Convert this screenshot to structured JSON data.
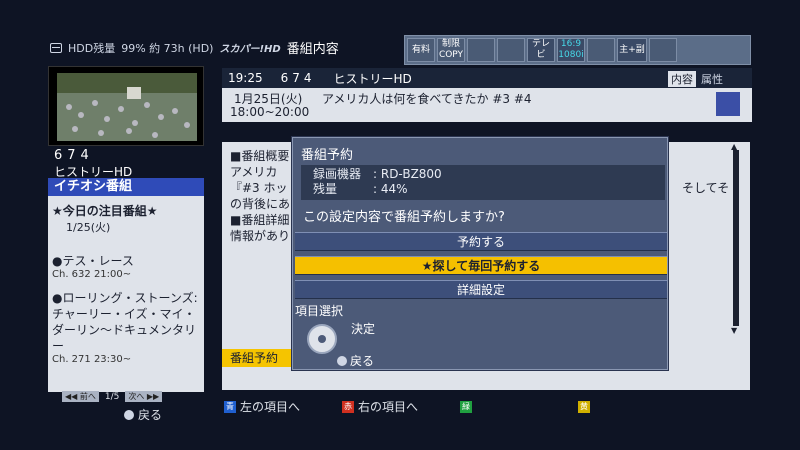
{
  "status": {
    "hdd_label": "HDD残量",
    "hdd_value": "99% 約 73h (HD)",
    "brand": "スカパー!HD",
    "screen_title": "番組内容"
  },
  "badges": [
    "有料",
    "制限COPY",
    "",
    "",
    "テレビ",
    "16:9 1080i",
    "",
    "主+副",
    ""
  ],
  "channel": {
    "number": "674",
    "name": "ヒストリーHD"
  },
  "left_panel": {
    "ichioshi": "イチオシ番組",
    "head": "★今日の注目番組★",
    "date": "1/25(火)",
    "items": [
      {
        "title": "●テス・レース",
        "meta": "Ch. 632 21:00~"
      },
      {
        "title": "●ローリング・ストーンズ:チャーリー・イズ・マイ・ダーリン〜ドキュメンタリー",
        "meta": "Ch. 271 23:30~"
      }
    ],
    "pager": {
      "prev": "前へ",
      "page": "1/5",
      "next": "次へ"
    },
    "back": "戻る"
  },
  "program": {
    "time": "19:25",
    "ch_num": "674",
    "ch_name": "ヒストリーHD",
    "tab_content": "内容",
    "tab_attr": "属性",
    "date": "1月25日(火)",
    "time_range": "18:00~20:00",
    "title": "アメリカ人は何を食べてきたか #3 #4"
  },
  "details": {
    "lines": [
      "■番組概要",
      "アメリカ",
      "『#3 ホッ",
      "の背後にあ",
      "■番組詳細",
      "情報があり"
    ],
    "right_text": "そしてそ",
    "tag": "番組予約"
  },
  "dialog": {
    "title": "番組予約",
    "device_label": "録画機器",
    "device_value": ": RD-BZ800",
    "remain_label": "残量",
    "remain_value": ": 44%",
    "question": "この設定内容で番組予約しますか?",
    "options": [
      "予約する",
      "★探して毎回予約する",
      "詳細設定"
    ],
    "help": "項目選択",
    "confirm": "決定",
    "back": "戻る"
  },
  "color_buttons": [
    {
      "key": "青",
      "label": "左の項目へ",
      "color": "#2060d0"
    },
    {
      "key": "赤",
      "label": "右の項目へ",
      "color": "#d03020"
    },
    {
      "key": "緑",
      "label": "",
      "color": "#20a040"
    },
    {
      "key": "黄",
      "label": "",
      "color": "#d0b000"
    }
  ]
}
